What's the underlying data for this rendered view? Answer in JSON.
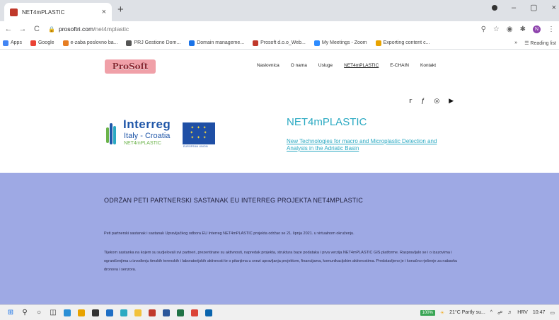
{
  "browser": {
    "tab_title": "NET4mPLASTIC",
    "tab_close": "×",
    "new_tab": "+",
    "url_host": "prosoftri.com",
    "url_path": "/net4mplastic",
    "nav": {
      "back": "←",
      "forward": "→",
      "reload": "C"
    },
    "window_controls": {
      "minimize": "–",
      "maximize": "▢",
      "close": "×"
    },
    "profile_initial": "N",
    "bookmarks": [
      {
        "label": "Apps",
        "color": "#4285f4"
      },
      {
        "label": "Google",
        "color": "#ea4335"
      },
      {
        "label": "e-zaba poslovno ba...",
        "color": "#e67e22"
      },
      {
        "label": "PRJ Gestione Dom...",
        "color": "#555555"
      },
      {
        "label": "Domain manageme...",
        "color": "#1a73e8"
      },
      {
        "label": "Prosoft d.o.o_Web...",
        "color": "#c0392b"
      },
      {
        "label": "My Meetings - Zoom",
        "color": "#2d8cff"
      },
      {
        "label": "Exporting content c...",
        "color": "#e8a300"
      }
    ],
    "reading_list": "Reading list"
  },
  "site": {
    "logo_text": "ProSoft",
    "nav": [
      "Naslovnica",
      "O nama",
      "Usluge",
      "NET4mPLASTIC",
      "E-CHAIN",
      "Kontakt"
    ],
    "social": [
      "twitter-icon",
      "facebook-icon",
      "instagram-icon",
      "youtube-icon"
    ],
    "interreg": {
      "word": "Interreg",
      "sub": "Italy - Croatia",
      "project": "NET4mPLASTIC",
      "eu_caption": "EUROPEAN UNION"
    },
    "project_title": "NET4mPLASTIC",
    "project_desc": "New Technologies for macro and Microplastic Detection and Analysis in the Adriatic Basin",
    "panel": {
      "heading": "ODRŽAN PETI PARTNERSKI SASTANAK EU INTERREG PROJEKTA NET4MPLASTIC",
      "p1": "Peti partnerski sastanak i sastanak Upravljačkog odbora EU Interreg NET4mPLASTIC projekta održao se 21. lipnja 2021. u virtualnom okruženju.",
      "p2": "Tijekom sastanka na kojem su sudjelovali svi partneri, prezentirane su aktivnosti, napredak projekta, struktura baze podataka i prva verzija NET4mPLASTIC GIS platforme. Raspravljalo se i o izazovima i ograničenjima u izvođenju timskih terenskih i laboratorijskih aktivnosti te o pitanjima u svezi upravljanja projektom, financijama, komunikacijskim aktivnostima. Predstavljeno je i konačno rješenje za nabavku dronova i senzora."
    }
  },
  "taskbar": {
    "battery": "100%",
    "weather": "21°C Partly su...",
    "lang": "HRV",
    "time": "10:47"
  }
}
